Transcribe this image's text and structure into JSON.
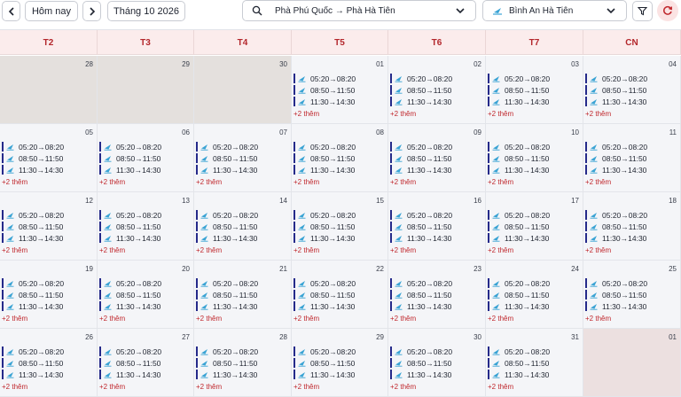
{
  "toolbar": {
    "today_label": "Hôm nay",
    "month_label": "Tháng 10 2026",
    "route_value": "Phà Phú Quốc → Phà Hà Tiên",
    "operator_value": "Bình An Hà Tiên"
  },
  "weekdays": [
    "T2",
    "T3",
    "T4",
    "T5",
    "T6",
    "T7",
    "CN"
  ],
  "weeks": [
    [
      {
        "day": "28",
        "other_month": true,
        "trips": []
      },
      {
        "day": "29",
        "other_month": true,
        "trips": []
      },
      {
        "day": "30",
        "other_month": true,
        "trips": []
      },
      {
        "day": "01",
        "trips": [
          "05:20→08:20",
          "08:50→11:50",
          "11:30→14:30"
        ],
        "more": "+2 thêm"
      },
      {
        "day": "02",
        "trips": [
          "05:20→08:20",
          "08:50→11:50",
          "11:30→14:30"
        ],
        "more": "+2 thêm"
      },
      {
        "day": "03",
        "trips": [
          "05:20→08:20",
          "08:50→11:50",
          "11:30→14:30"
        ],
        "more": "+2 thêm"
      },
      {
        "day": "04",
        "trips": [
          "05:20→08:20",
          "08:50→11:50",
          "11:30→14:30"
        ],
        "more": "+2 thêm"
      }
    ],
    [
      {
        "day": "05",
        "trips": [
          "05:20→08:20",
          "08:50→11:50",
          "11:30→14:30"
        ],
        "more": "+2 thêm"
      },
      {
        "day": "06",
        "trips": [
          "05:20→08:20",
          "08:50→11:50",
          "11:30→14:30"
        ],
        "more": "+2 thêm"
      },
      {
        "day": "07",
        "trips": [
          "05:20→08:20",
          "08:50→11:50",
          "11:30→14:30"
        ],
        "more": "+2 thêm"
      },
      {
        "day": "08",
        "trips": [
          "05:20→08:20",
          "08:50→11:50",
          "11:30→14:30"
        ],
        "more": "+2 thêm"
      },
      {
        "day": "09",
        "trips": [
          "05:20→08:20",
          "08:50→11:50",
          "11:30→14:30"
        ],
        "more": "+2 thêm"
      },
      {
        "day": "10",
        "trips": [
          "05:20→08:20",
          "08:50→11:50",
          "11:30→14:30"
        ],
        "more": "+2 thêm"
      },
      {
        "day": "11",
        "trips": [
          "05:20→08:20",
          "08:50→11:50",
          "11:30→14:30"
        ],
        "more": "+2 thêm"
      }
    ],
    [
      {
        "day": "12",
        "trips": [
          "05:20→08:20",
          "08:50→11:50",
          "11:30→14:30"
        ],
        "more": "+2 thêm"
      },
      {
        "day": "13",
        "trips": [
          "05:20→08:20",
          "08:50→11:50",
          "11:30→14:30"
        ],
        "more": "+2 thêm"
      },
      {
        "day": "14",
        "trips": [
          "05:20→08:20",
          "08:50→11:50",
          "11:30→14:30"
        ],
        "more": "+2 thêm"
      },
      {
        "day": "15",
        "trips": [
          "05:20→08:20",
          "08:50→11:50",
          "11:30→14:30"
        ],
        "more": "+2 thêm"
      },
      {
        "day": "16",
        "trips": [
          "05:20→08:20",
          "08:50→11:50",
          "11:30→14:30"
        ],
        "more": "+2 thêm"
      },
      {
        "day": "17",
        "trips": [
          "05:20→08:20",
          "08:50→11:50",
          "11:30→14:30"
        ],
        "more": "+2 thêm"
      },
      {
        "day": "18",
        "trips": [
          "05:20→08:20",
          "08:50→11:50",
          "11:30→14:30"
        ],
        "more": "+2 thêm"
      }
    ],
    [
      {
        "day": "19",
        "trips": [
          "05:20→08:20",
          "08:50→11:50",
          "11:30→14:30"
        ],
        "more": "+2 thêm"
      },
      {
        "day": "20",
        "trips": [
          "05:20→08:20",
          "08:50→11:50",
          "11:30→14:30"
        ],
        "more": "+2 thêm"
      },
      {
        "day": "21",
        "trips": [
          "05:20→08:20",
          "08:50→11:50",
          "11:30→14:30"
        ],
        "more": "+2 thêm"
      },
      {
        "day": "22",
        "trips": [
          "05:20→08:20",
          "08:50→11:50",
          "11:30→14:30"
        ],
        "more": "+2 thêm"
      },
      {
        "day": "23",
        "trips": [
          "05:20→08:20",
          "08:50→11:50",
          "11:30→14:30"
        ],
        "more": "+2 thêm"
      },
      {
        "day": "24",
        "trips": [
          "05:20→08:20",
          "08:50→11:50",
          "11:30→14:30"
        ],
        "more": "+2 thêm"
      },
      {
        "day": "25",
        "trips": [
          "05:20→08:20",
          "08:50→11:50",
          "11:30→14:30"
        ],
        "more": "+2 thêm"
      }
    ],
    [
      {
        "day": "26",
        "trips": [
          "05:20→08:20",
          "08:50→11:50",
          "11:30→14:30"
        ],
        "more": "+2 thêm"
      },
      {
        "day": "27",
        "trips": [
          "05:20→08:20",
          "08:50→11:50",
          "11:30→14:30"
        ],
        "more": "+2 thêm"
      },
      {
        "day": "28",
        "trips": [
          "05:20→08:20",
          "08:50→11:50",
          "11:30→14:30"
        ],
        "more": "+2 thêm"
      },
      {
        "day": "29",
        "trips": [
          "05:20→08:20",
          "08:50→11:50",
          "11:30→14:30"
        ],
        "more": "+2 thêm"
      },
      {
        "day": "30",
        "trips": [
          "05:20→08:20",
          "08:50→11:50",
          "11:30→14:30"
        ],
        "more": "+2 thêm"
      },
      {
        "day": "31",
        "trips": [
          "05:20→08:20",
          "08:50→11:50",
          "11:30→14:30"
        ],
        "more": "+2 thêm"
      },
      {
        "day": "01",
        "other_month": true,
        "trips": []
      }
    ]
  ],
  "icons": {
    "prev": "chevron-left-icon",
    "next": "chevron-right-icon",
    "search": "search-icon",
    "dropdown": "chevron-down-icon",
    "operator": "ship-icon",
    "filter": "filter-icon",
    "refresh": "refresh-icon",
    "trip": "ferry-icon"
  },
  "colors": {
    "accent": "#b3262b",
    "trip_bar": "#252a8a",
    "trip_icon": "#3aa3d4",
    "header_bg": "#fbecec"
  }
}
